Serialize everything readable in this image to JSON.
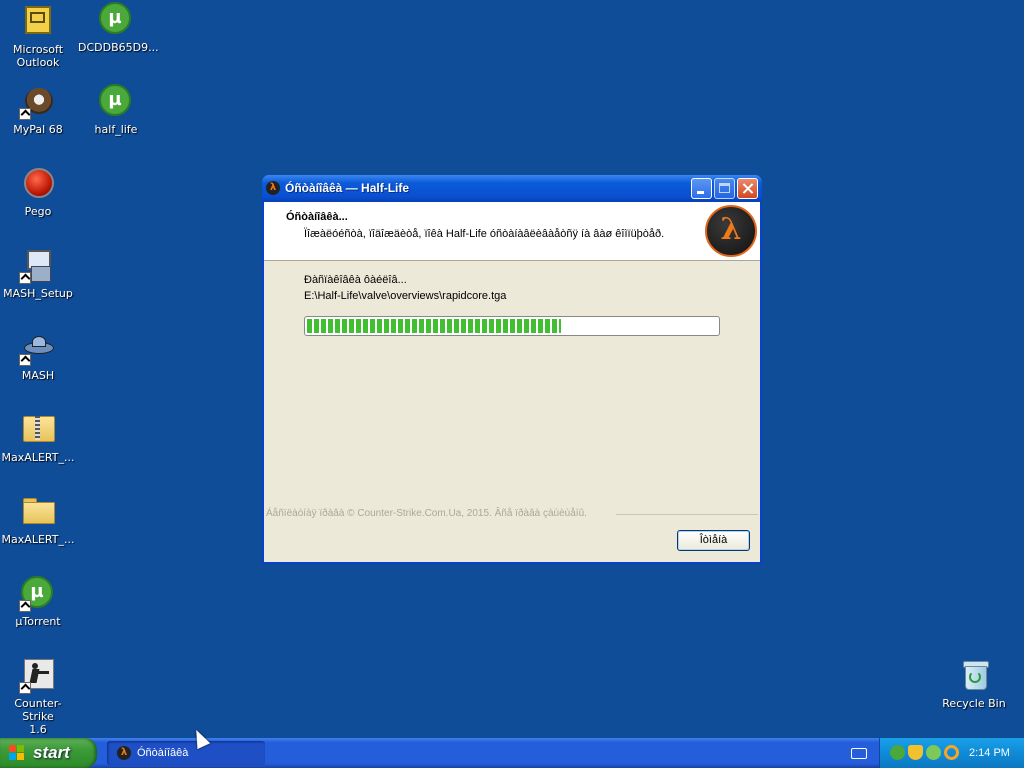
{
  "desktop": {
    "icons": [
      {
        "label": "Microsoft\nOutlook",
        "icon": "outlook-icon"
      },
      {
        "label": "DCDDB65D9...",
        "icon": "utorrent-file-icon"
      },
      {
        "label": "MyPal 68",
        "icon": "mypal-icon"
      },
      {
        "label": "half_life",
        "icon": "utorrent-file-icon"
      },
      {
        "label": "Pego",
        "icon": "pego-icon"
      },
      {
        "label": "MASH_Setup",
        "icon": "installer-icon"
      },
      {
        "label": "MASH",
        "icon": "mash-icon"
      },
      {
        "label": "MaxALERT_...",
        "icon": "zip-folder-icon"
      },
      {
        "label": "MaxALERT_...",
        "icon": "folder-icon"
      },
      {
        "label": "µTorrent",
        "icon": "utorrent-icon"
      },
      {
        "label": "Counter-Strike\n1.6",
        "icon": "counter-strike-icon"
      },
      {
        "label": "Recycle Bin",
        "icon": "recycle-bin-icon"
      }
    ]
  },
  "dialog": {
    "title": "Óñòàíîâêà — Half-Life",
    "heading": "Óñòàíîâêà...",
    "subheading": "Ïîæàëóéñòà, ïîäîæäèòå, ïîêà Half-Life óñòàíàâëèâàåòñÿ íà âàø êîìïüþòåð.",
    "status": "Ðàñïàêîâêà ôàéëîâ...",
    "file_path": "E:\\Half-Life\\valve\\overviews\\rapidcore.tga",
    "progress": 0.62,
    "branding": "Áåñïëàòíàÿ ïðàâà © Counter-Strike.Com.Ua, 2015. Âñå ïðàâà çàùèùåíû.",
    "cancel_label": "Îòìåíà"
  },
  "taskbar": {
    "start_label": "start",
    "task_label": "Óñòàíîâêà",
    "clock": "2:14 PM"
  },
  "colors": {
    "desktop": "#0f4d99",
    "titlebar": "#0b5bd8",
    "progress": "#40c030",
    "start": "#3c9a38"
  }
}
